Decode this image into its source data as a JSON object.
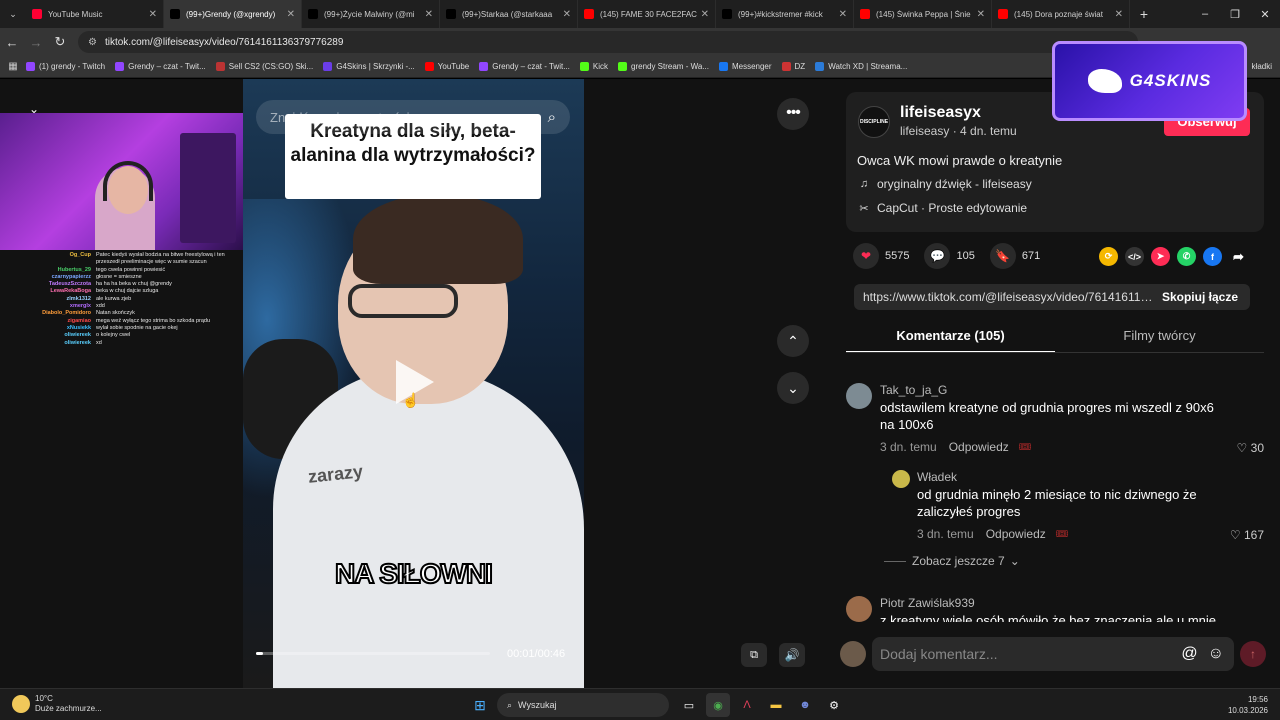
{
  "browser": {
    "tabs": [
      {
        "title": "YouTube Music",
        "icon": "youtube-music-icon",
        "color": "#ff0033",
        "active": false
      },
      {
        "title": "(99+)Grendy (@xgrendy)",
        "icon": "tiktok-icon",
        "color": "#000000",
        "active": true
      },
      {
        "title": "(99+)Życie Malwiny (@mi",
        "icon": "tiktok-icon",
        "color": "#000000",
        "active": false
      },
      {
        "title": "(99+)Starkaa (@starkaaa",
        "icon": "tiktok-icon",
        "color": "#000000",
        "active": false
      },
      {
        "title": "(145) FAME 30 FACE2FACE",
        "icon": "youtube-icon",
        "color": "#ff0000",
        "active": false
      },
      {
        "title": "(99+)#kickstremer #kick",
        "icon": "tiktok-icon",
        "color": "#000000",
        "active": false
      },
      {
        "title": "(145) Świnka Peppa | Śnie",
        "icon": "youtube-icon",
        "color": "#ff0000",
        "active": false
      },
      {
        "title": "(145) Dora poznaje świat",
        "icon": "youtube-icon",
        "color": "#ff0000",
        "active": false
      }
    ],
    "url": "tiktok.com/@lifeiseasyx/video/7614161136379776289",
    "bookmarks": [
      {
        "label": "(1) grendy - Twitch",
        "color": "#9146ff"
      },
      {
        "label": "Grendy – czat - Twit...",
        "color": "#9146ff"
      },
      {
        "label": "Sell CS2 (CS:GO) Ski...",
        "color": "#b33"
      },
      {
        "label": "G4Skins | Skrzynki -...",
        "color": "#6a3de8"
      },
      {
        "label": "YouTube",
        "color": "#ff0000"
      },
      {
        "label": "Grendy – czat - Twit...",
        "color": "#9146ff"
      },
      {
        "label": "Kick",
        "color": "#53fc18"
      },
      {
        "label": "grendy Stream - Wa...",
        "color": "#53fc18"
      },
      {
        "label": "Messenger",
        "color": "#1877f2"
      },
      {
        "label": "DZ",
        "color": "#c33"
      },
      {
        "label": "Watch XD | Streama...",
        "color": "#2b7bd8"
      }
    ],
    "bookmarks_other": "kładki"
  },
  "stream_chat": [
    {
      "user": "Og_Cup",
      "color": "#f0c040",
      "text": "Patec kiedyś wysłał bodzia na bitwe freestylową i ten przeszedł preeliminacje więc w sumie szacun"
    },
    {
      "user": "Hubertus_29",
      "color": "#4ad06a",
      "text": "tego cwela powinni powiesić"
    },
    {
      "user": "czarnypapierzz",
      "color": "#7aa7ff",
      "text": "głosne = smieszne"
    },
    {
      "user": "TadeuszSzczota",
      "color": "#c07bff",
      "text": "ha ha ha beka w chuj @grendy"
    },
    {
      "user": "LewaRekaBoga",
      "color": "#ff6fb0",
      "text": "beka w chuj dajcie szluga"
    },
    {
      "user": "zlmk1312",
      "color": "#9ad1ff",
      "text": "ale kurwa zjeb"
    },
    {
      "user": "xmerglx",
      "color": "#b36cff",
      "text": "xdd"
    },
    {
      "user": "Diabolo_Pomidoro",
      "color": "#ff9d3a",
      "text": "Natan skończyk"
    },
    {
      "user": "zigamiao",
      "color": "#ff4a4a",
      "text": "mega weź wyłącz tego strima bo szkoda prądu"
    },
    {
      "user": "xNusiekk",
      "color": "#3ac0ff",
      "text": "wylał sobie spodnie na gacie okej"
    },
    {
      "user": "oliwiereek",
      "color": "#5ad0ff",
      "text": "o kolejny cwel"
    },
    {
      "user": "oliwiereek",
      "color": "#5ad0ff",
      "text": "xd"
    }
  ],
  "video": {
    "search_placeholder": "Znajdź powiązane treści",
    "overlay_text": "Kreatyna dla siły, beta-alanina dla wytrzymałości?",
    "subtitle": "NA SIŁOWNI",
    "shirt_brand": "zarazy",
    "timecode": "00:01/00:46",
    "progress": 0.03
  },
  "post": {
    "username": "lifeiseasyx",
    "avatar_text": "DISCIPLINE",
    "submeta": "lifeiseasy · 4 dn. temu",
    "follow_label": "Obserwuj",
    "caption": "Owca WK mowi prawde o kreatynie",
    "sound": "oryginalny dźwięk - lifeiseasy",
    "capcut": "CapCut · Proste edytowanie",
    "likes": "5575",
    "comments": "105",
    "saves": "671",
    "link": "https://www.tiktok.com/@lifeiseasyx/video/7614161136379776289",
    "copy_label": "Skopiuj łącze"
  },
  "comment_tabs": {
    "comments": "Komentarze (105)",
    "creator": "Filmy twórcy"
  },
  "comments": [
    {
      "name": "Tak_to_ja_G",
      "text": "odstawilem kreatyne od grudnia progres mi wszedl z 90x6 na 100x6",
      "time": "3 dn. temu",
      "reply": "Odpowiedz",
      "likes": "30"
    },
    {
      "name": "Władek",
      "text": "od grudnia minęło 2 miesiące to nic dziwnego że zaliczyłeś progres",
      "time": "3 dn. temu",
      "reply": "Odpowiedz",
      "likes": "167"
    },
    {
      "name": "Piotr Zawiślak939",
      "text": "z kreatyny wiele osób mówiło że bez znaczenia ale u mnie"
    }
  ],
  "more_replies": "Zobacz jeszcze 7",
  "comment_placeholder": "Dodaj komentarz...",
  "g4skins": "G4SKINS",
  "taskbar": {
    "temp": "10°C",
    "weather": "Duże zachmurze...",
    "search": "Wyszukaj",
    "time": "19:56",
    "date": "10.03.2026"
  }
}
